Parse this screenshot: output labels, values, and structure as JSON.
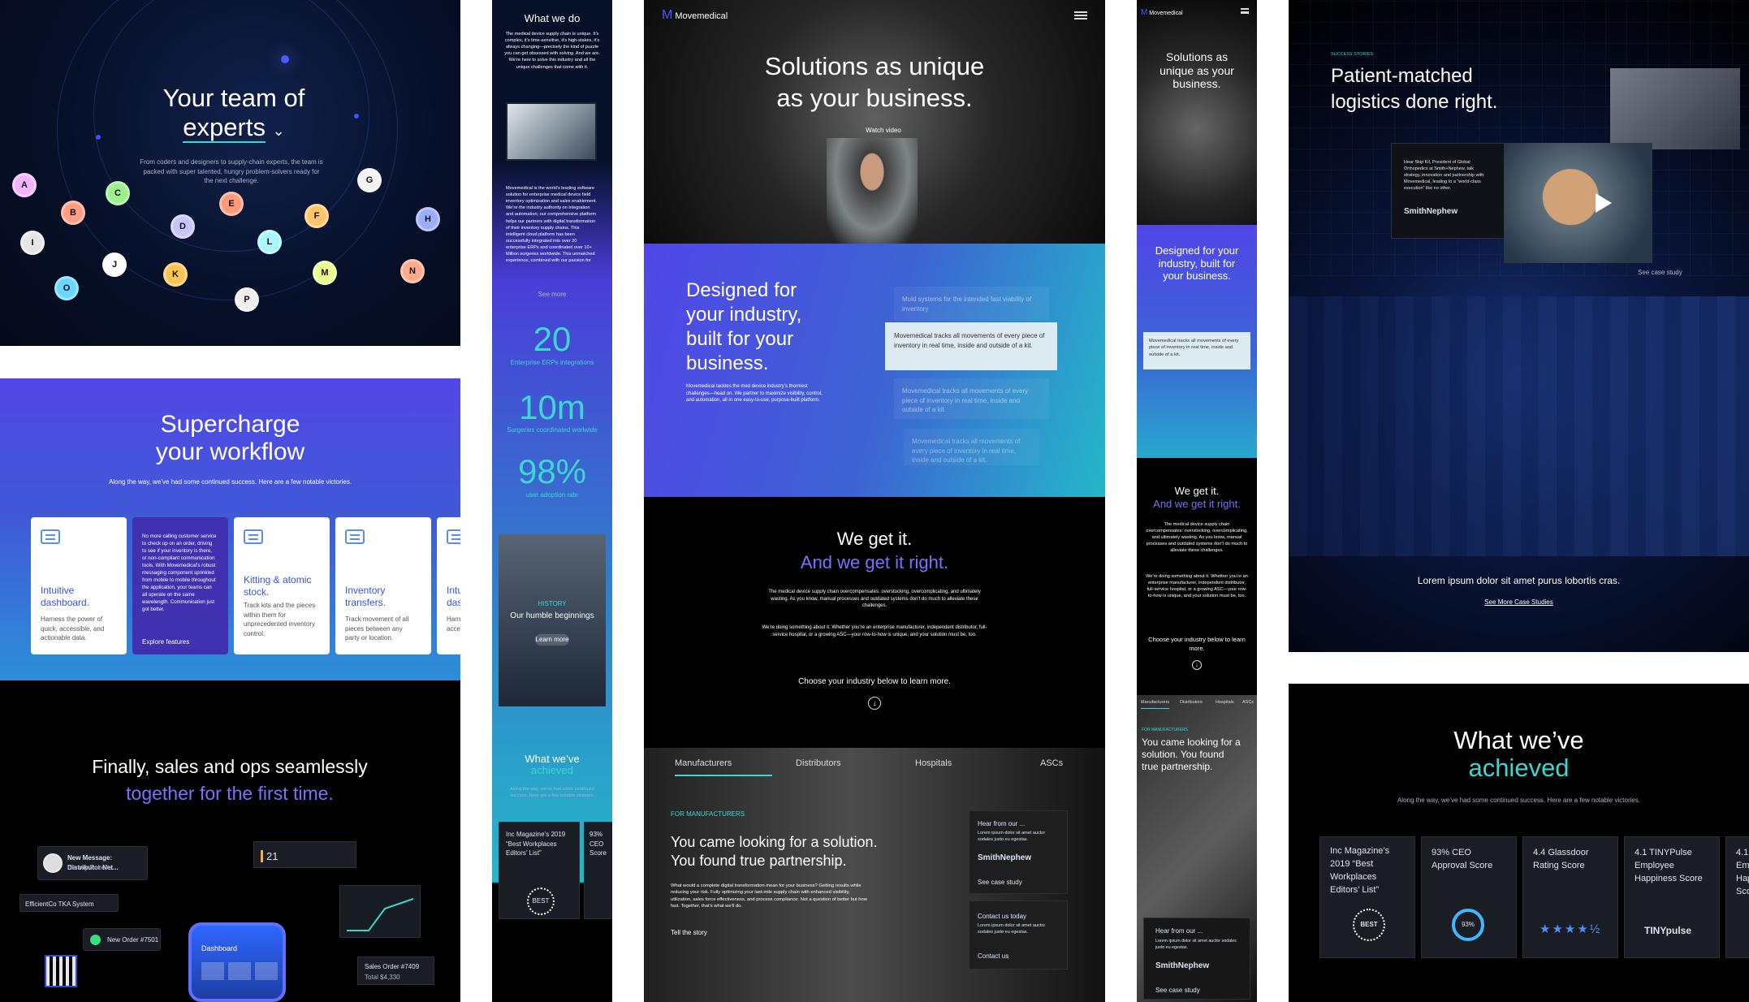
{
  "colors": {
    "navy": "#071029",
    "blue": "#5146e8",
    "teal": "#24b7c8",
    "cyan": "#3dd6d1",
    "black": "#000000"
  },
  "panel1": {
    "title_line1": "Your team of",
    "title_line2": "experts",
    "chevron": "⌄",
    "body": "From coders and designers to supply-chain experts, the team is packed with super talented, hungry problem-solvers ready for the next challenge."
  },
  "panel2": {
    "title_line1": "Supercharge",
    "title_line2": "your workflow",
    "subtitle": "Along the way, we’ve had some continued success. Here are a few notable victories.",
    "cards": [
      {
        "title": "Intuitive dashboard.",
        "body": "Harness the power of quick, accessible, and actionable data."
      },
      {
        "body": "No more calling customer service to check up on an order, driving to see if your inventory is there, or non-compliant communication tools. With Movemedical’s robust messaging component sprinkled from mobile to mobile throughout the application, your teams can all operate on the same wavelength. Communication just got better.",
        "link": "Explore features"
      },
      {
        "title": "Kitting & atomic stock.",
        "body": "Track kits and the pieces within them for unprecedented inventory control."
      },
      {
        "title": "Inventory transfers.",
        "body": "Track movement of all pieces between any party or location."
      },
      {
        "title": "Intu das",
        "body": "Harn acce"
      }
    ]
  },
  "panel3": {
    "title_line1": "Finally, sales and ops seamlessly",
    "title_line2": "together for the first time.",
    "new_message": "New Message: Distributor Net...",
    "person": "Harvey Roberts",
    "system": "EfficientCo TKA System",
    "new_order": "New Order #7501",
    "dashboard": "Dashboard",
    "sales_order": "Sales Order #7409",
    "sales_total": "Total $4,330",
    "date": "21"
  },
  "panel4": {
    "heading": "What we do",
    "body1": "The medical device supply chain is unique. It’s complex, it’s time-sensitive, it’s high-stakes, it’s always changing—precisely the kind of puzzle you can get obsessed with solving. And we are. We’re here to solve this industry and all the unique challenges that come with it.",
    "body2": "Movemedical is the world’s leading software solution for enterprise medical device field inventory optimization and sales enablement. We’re the industry authority on integration and automation; our comprehensive platform helps our partners with digital transformation of their inventory supply chains. This intelligent cloud platform has been successfully integrated into over 20 enterprise ERPs and coordinated over 10+ Million surgeries worldwide. This unmatched experience, combined with our passion for",
    "see_more": "See more",
    "stats": [
      {
        "value": "20",
        "label": "Enterprise ERPs integrations"
      },
      {
        "value": "10m",
        "label": "Surgeries coordinated worlwide"
      },
      {
        "value": "98%",
        "label": "user adoption rate"
      }
    ],
    "humble": "Our humble beginnings",
    "history": "HISTORY",
    "learn_more": "Learn more",
    "achieved_line1": "What we’ve",
    "achieved_line2": "achieved",
    "achieved_body": "Along the way, we’ve had some continued success. Here are a few notable victories.",
    "award": "Inc Magazine’s 2019 “Best Workplaces Editors’ List”",
    "ceo_partial": "93% CEO Score"
  },
  "panel5": {
    "brand": "Movemedical",
    "hero_line1": "Solutions as unique",
    "hero_line2": "as your business.",
    "watch": "Watch video",
    "designed_line1": "Designed for",
    "designed_line2": "your industry,",
    "designed_line3": "built for your",
    "designed_line4": "business.",
    "designed_body": "Movemedical tackles the med device industry’s thorniest challenges—head on. We partner to maximize visibility, control, and automation, all in one easy-to-use, purpose-built platform.",
    "stack": [
      "Mold systems for the intended fast viability of inventory",
      "Movemedical tracks all movements of every piece of inventory in real time, inside and outside of a kit.",
      "Movemedical tracks all movements of every piece of inventory in real time, inside and outside of a kit.",
      "Movemedical tracks all movements of every piece of inventory in real time, inside and outside of a kit."
    ],
    "we_get": "We get it.",
    "we_right": "And we get it right.",
    "we_body1": "The medical device supply chain overcompensates: overstocking, overcomplicating, and ultimately wasting. As you know, manual processes and outdated systems don’t do much to alleviate these challenges.",
    "we_body2": "We’re doing something about it. Whether you’re an enterprise manufacturer, independent distributor, full-service hospital, or a growing ASC—your row-to-how is unique, and your solution must be, too.",
    "choose": "Choose your industry below to learn more.",
    "tabs": [
      "Manufacturers",
      "Distributors",
      "Hospitals",
      "ASCs"
    ],
    "manufacturers_tag": "FOR MANUFACTURERS",
    "solution_line1": "You came looking for a solution.",
    "solution_line2": "You found true partnership.",
    "solution_body": "What would a complete digital transformation mean for your business? Getting results while reducing your risk. Fully optimizing your last-mile supply chain with enhanced visibility, utilization, sales force effectiveness, and process compliance. Not a question of better but how fast. Together, that’s what we’ll do.",
    "tell_story": "Tell the story",
    "hear": "Hear from our ...",
    "hear_body": "Lorem ipsum dolor sit amet auctor sodales justo eu egestas.",
    "company": "SmithNephew",
    "case_study": "See case study",
    "contact": "Contact us today",
    "contact_body": "Lorem ipsum dolor sit amet auctor sodales justo eu egestas.",
    "contact_link": "Contact us"
  },
  "panel6": {
    "brand": "Movemedical",
    "hero_line1": "Solutions as",
    "hero_line2": "unique as your",
    "hero_line3": "business.",
    "designed_line1": "Designed for your",
    "designed_line2": "industry, built for",
    "designed_line3": "your business.",
    "active": "Movemedical tracks all movements of every piece of inventory in real time, inside and outside of a kit.",
    "we_get": "We get it.",
    "we_right": "And we get it right.",
    "body": "The medical device supply chain overcompensates: overstocking, overcomplicating, and ultimately wasting. As you know, manual processes and outdated systems don’t do much to alleviate these challenges.",
    "body2": "We’re doing something about it. Whether you’re an enterprise manufacturer, independent distributor, full-service hospital, or a growing ASC—your row-to-how is unique, and your solution must be, too.",
    "choose": "Choose your industry below to learn more.",
    "tabs": [
      "Manufacturers",
      "Distributors",
      "Hospitals",
      "ASCs"
    ],
    "manufacturers_tag": "FOR MANUFACTURERS",
    "solution": "You came looking for a solution. You found true partnership.",
    "hear": "Hear from our ...",
    "hear_body": "Lorem ipsum dolor sit amet auctor sodales justo eu egestas.",
    "company": "SmithNephew",
    "case_study": "See case study"
  },
  "panel7": {
    "tag": "SUCCESS STORIES",
    "title_line1": "Patient-matched",
    "title_line2": "logistics done right.",
    "quote": "Hear Skip Kil, President of Global Orthopedics at Smith+Nephew, talk strategy, innovation and partnership with Movemedical, leading to a “world-class execution” like no other.",
    "company": "SmithNephew",
    "case_study": "See case study",
    "lorem": "Lorem ipsum dolor sit amet purus lobortis cras.",
    "see_more": "See More Case Studies"
  },
  "panel8": {
    "title_line1": "What we’ve",
    "title_line2": "achieved",
    "subtitle": "Along the way, we’ve had some continued success. Here are a few notable victories.",
    "cards": [
      {
        "title": "Inc Magazine’s 2019 “Best Workplaces Editors’ List”",
        "mark": "BEST"
      },
      {
        "title": "93% CEO Approval Score",
        "mark": "93%"
      },
      {
        "title": "4.4 Glassdoor Rating Score",
        "mark": "★★★★½"
      },
      {
        "title": "4.1 TINYPulse Employee Happiness Score",
        "mark": "TINYpulse"
      },
      {
        "title": "4.1 T Emp Hap Sco",
        "mark": ""
      }
    ]
  }
}
